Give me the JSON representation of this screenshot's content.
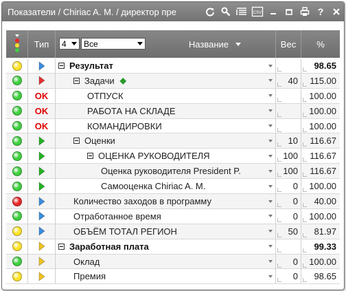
{
  "window": {
    "title": "Показатели / Chiriac A. M. / директор пре"
  },
  "toolbar": {
    "icons": [
      "refresh-icon",
      "search-icon",
      "list-icon",
      "export-csv-icon",
      "minimize-icon",
      "restore-icon",
      "print-icon",
      "help-icon",
      "close-icon"
    ]
  },
  "header": {
    "type_label": "Тип",
    "name_label": "Название",
    "weight_label": "Вес",
    "percent_label": "%",
    "level_value": "4",
    "filter_value": "Все"
  },
  "colors": {
    "green": "#3fcf3f",
    "yellow": "#ffe22a",
    "red": "#e82828",
    "blue_arrow": "#3a8ee0",
    "red_arrow": "#e83030",
    "green_arrow": "#22b422",
    "yellow_arrow": "#f2c31b"
  },
  "rows": [
    {
      "light": "yellow",
      "type": "blue",
      "name": "Результат",
      "indent": 0,
      "expand": true,
      "bold": true,
      "weight": "",
      "percent": "98.65"
    },
    {
      "light": "green",
      "type": "red",
      "name": "Задачи",
      "indent": 1,
      "expand": true,
      "bold": false,
      "weight": "40",
      "percent": "115.00",
      "plus": true
    },
    {
      "light": "green",
      "type": "ok",
      "name": "ОТПУСК",
      "indent": 2,
      "expand": false,
      "bold": false,
      "weight": "",
      "percent": "100.00"
    },
    {
      "light": "green",
      "type": "ok",
      "name": "РАБОТА НА СКЛАДЕ",
      "indent": 2,
      "expand": false,
      "bold": false,
      "weight": "",
      "percent": "100.00"
    },
    {
      "light": "green",
      "type": "ok",
      "name": "КОМАНДИРОВКИ",
      "indent": 2,
      "expand": false,
      "bold": false,
      "weight": "",
      "percent": "100.00"
    },
    {
      "light": "green",
      "type": "green",
      "name": "Оценки",
      "indent": 1,
      "expand": true,
      "bold": false,
      "weight": "10",
      "percent": "116.67"
    },
    {
      "light": "green",
      "type": "green",
      "name": "ОЦЕНКА РУКОВОДИТЕЛЯ",
      "indent": 2,
      "expand": true,
      "bold": false,
      "weight": "100",
      "percent": "116.67"
    },
    {
      "light": "green",
      "type": "green",
      "name": "Оценка руководителя President P.",
      "indent": 3,
      "expand": false,
      "bold": false,
      "weight": "100",
      "percent": "116.67"
    },
    {
      "light": "green",
      "type": "green",
      "name": "Самооценка Chiriac A. M.",
      "indent": 3,
      "expand": false,
      "bold": false,
      "weight": "0",
      "percent": "100.00"
    },
    {
      "light": "red",
      "type": "blue",
      "name": "Количество заходов в программу",
      "indent": 1,
      "expand": false,
      "bold": false,
      "weight": "0",
      "percent": "40.00"
    },
    {
      "light": "green",
      "type": "blue",
      "name": "Отработанное время",
      "indent": 1,
      "expand": false,
      "bold": false,
      "weight": "0",
      "percent": "100.00"
    },
    {
      "light": "yellow",
      "type": "blue",
      "name": "ОБЪЁМ ТОТАЛ РЕГИОН",
      "indent": 1,
      "expand": false,
      "bold": false,
      "weight": "50",
      "percent": "81.97"
    },
    {
      "light": "yellow",
      "type": "yellow",
      "name": "Заработная плата",
      "indent": 0,
      "expand": true,
      "bold": true,
      "weight": "",
      "percent": "99.33"
    },
    {
      "light": "green",
      "type": "yellow",
      "name": "Оклад",
      "indent": 1,
      "expand": false,
      "bold": false,
      "weight": "0",
      "percent": "100.00"
    },
    {
      "light": "yellow",
      "type": "yellow",
      "name": "Премия",
      "indent": 1,
      "expand": false,
      "bold": false,
      "weight": "0",
      "percent": "98.65"
    }
  ],
  "ok_label": "OK"
}
